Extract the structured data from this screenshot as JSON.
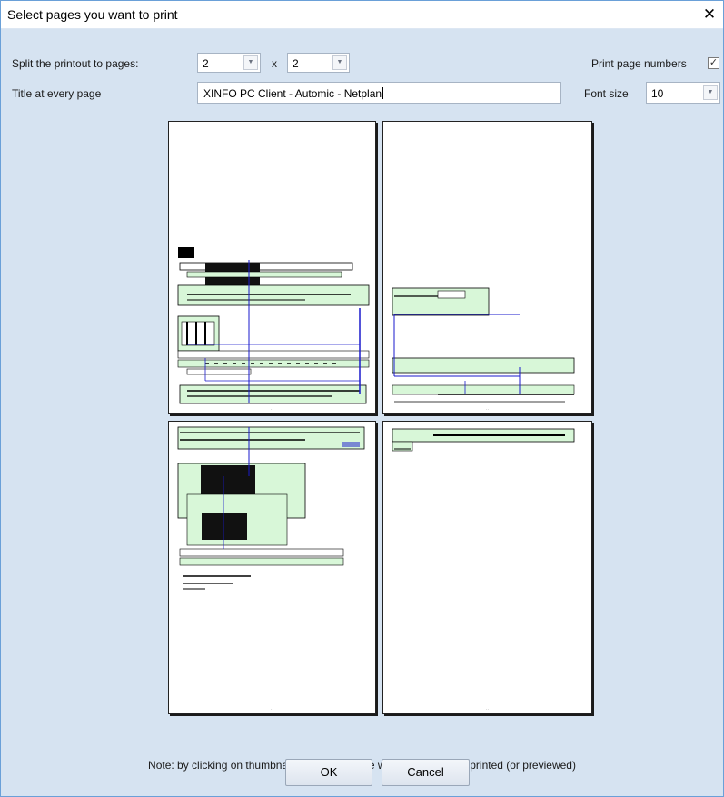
{
  "dialog": {
    "title": "Select pages you want to print",
    "close_glyph": "✕"
  },
  "split": {
    "label": "Split the printout to pages:",
    "cols_value": "2",
    "rows_value": "2",
    "separator": "x"
  },
  "print_numbers": {
    "label": "Print page numbers",
    "checked": true,
    "check_glyph": "✓"
  },
  "title_row": {
    "label": "Title at every page",
    "value": "XINFO PC Client - Automic - Netplan"
  },
  "font_size": {
    "label": "Font size",
    "value": "10"
  },
  "thumbnails": [
    {
      "name": "page-1-1"
    },
    {
      "name": "page-1-2"
    },
    {
      "name": "page-2-1"
    },
    {
      "name": "page-2-2"
    }
  ],
  "note": "Note: by clicking on thumbnails you can decide what pages will be printed (or previewed)",
  "buttons": {
    "ok": "OK",
    "cancel": "Cancel"
  },
  "colors": {
    "accent_border": "#6aa0d8",
    "background": "#d6e3f1",
    "node_fill": "#d8f7d8",
    "edge_line": "#1a1acc"
  }
}
